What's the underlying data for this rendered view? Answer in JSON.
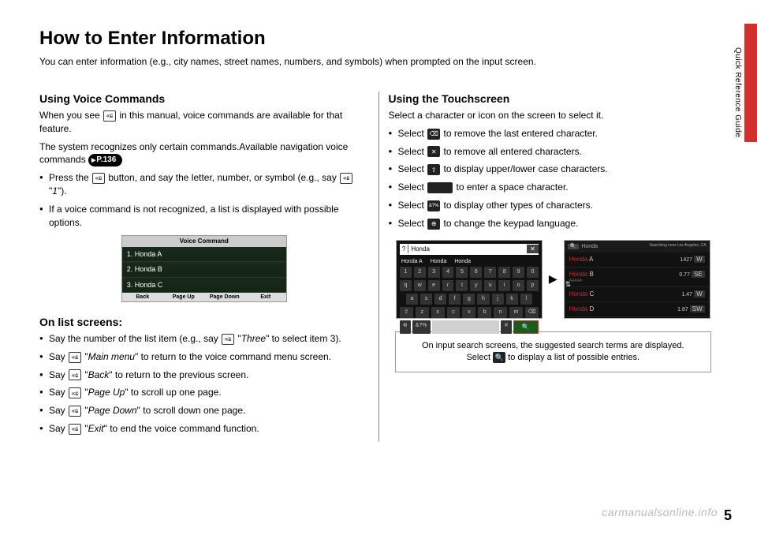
{
  "page": {
    "title": "How to Enter Information",
    "subtitle": "You can enter information (e.g., city names, street names, numbers, and symbols) when prompted on the input screen.",
    "side_label": "Quick Reference Guide",
    "page_number": "5",
    "watermark": "carmanualsonline.info"
  },
  "voice": {
    "heading": "Using Voice Commands",
    "intro1a": "When you see ",
    "intro1b": " in this manual, voice commands are available for that feature.",
    "intro2": "The system recognizes only certain commands.Available navigation voice commands ",
    "page_link": "P.136",
    "bullets": [
      {
        "a": "Press the ",
        "b": " button, and say the letter, number, or symbol (e.g., say ",
        "c": " \"",
        "d": "1",
        "e": "\")."
      },
      {
        "a": "If a voice command is not recognized, a list is displayed with possible options."
      }
    ],
    "screen": {
      "title": "Voice Command",
      "items": [
        "1. Honda A",
        "2. Honda B",
        "3. Honda C"
      ],
      "footer": [
        "Back",
        "Page Up",
        "Page Down",
        "Exit"
      ]
    }
  },
  "list": {
    "heading": "On list screens:",
    "items": [
      {
        "a": "Say the number of the list item (e.g., say ",
        "cmd": "Three",
        "b": " to select item 3)."
      },
      {
        "a": "Say ",
        "cmd": "Main menu",
        "b": " to return to the voice command menu screen."
      },
      {
        "a": "Say ",
        "cmd": "Back",
        "b": " to return to the previous screen."
      },
      {
        "a": "Say ",
        "cmd": "Page Up",
        "b": " to scroll up one page."
      },
      {
        "a": "Say ",
        "cmd": "Page Down",
        "b": " to scroll down one page."
      },
      {
        "a": "Say ",
        "cmd": "Exit",
        "b": " to end the voice command function."
      }
    ]
  },
  "touch": {
    "heading": "Using the Touchscreen",
    "intro": "Select a character or icon on the screen to select it.",
    "items": [
      {
        "a": "Select ",
        "icon": "delete-x-icon",
        "glyph": "⌫",
        "b": " to remove the last entered character."
      },
      {
        "a": "Select ",
        "icon": "clear-x-icon",
        "glyph": "✕",
        "b": " to remove all entered characters."
      },
      {
        "a": "Select ",
        "icon": "shift-icon",
        "glyph": "⇧",
        "b": " to display upper/lower case characters."
      },
      {
        "a": "Select ",
        "icon": "space-icon",
        "glyph": " ",
        "wide": true,
        "b": " to enter a space character."
      },
      {
        "a": "Select ",
        "icon": "symbols-icon",
        "glyph": "&?%",
        "b": " to display other types of characters."
      },
      {
        "a": "Select ",
        "icon": "globe-icon",
        "glyph": "⊕",
        "b": " to change the keypad language."
      }
    ],
    "kb": {
      "input": "Honda",
      "suggest": [
        "Honda A",
        "Honda",
        "Honda"
      ],
      "row1": [
        "1",
        "2",
        "3",
        "4",
        "5",
        "6",
        "7",
        "8",
        "9",
        "0"
      ],
      "row2": [
        "q",
        "w",
        "e",
        "r",
        "t",
        "y",
        "u",
        "i",
        "o",
        "p"
      ],
      "row3": [
        "a",
        "s",
        "d",
        "f",
        "g",
        "h",
        "j",
        "k",
        "l"
      ],
      "row4": [
        "⇧",
        "z",
        "x",
        "c",
        "v",
        "b",
        "n",
        "m",
        "⌫"
      ],
      "bottom": {
        "globe": "⊕",
        "sym": "&?%",
        "del": "✕"
      },
      "search_hint": "Searching near Los Angeles, CA"
    },
    "results": [
      {
        "name_r": "Honda",
        "name_w": " A",
        "sub": "",
        "dist": "1427",
        "dir": "W"
      },
      {
        "name_r": "Honda",
        "name_w": " B",
        "sub": "AAAAA",
        "dist": "0.77",
        "dir": "SE"
      },
      {
        "name_r": "Honda",
        "name_w": " C",
        "sub": "",
        "dist": "1.47",
        "dir": "W"
      },
      {
        "name_r": "Honda",
        "name_w": " D",
        "sub": "",
        "dist": "1.87",
        "dir": "SW"
      }
    ],
    "caption_a": "On input search screens, the suggested search terms are displayed. Select ",
    "caption_b": " to display a list of possible entries."
  }
}
